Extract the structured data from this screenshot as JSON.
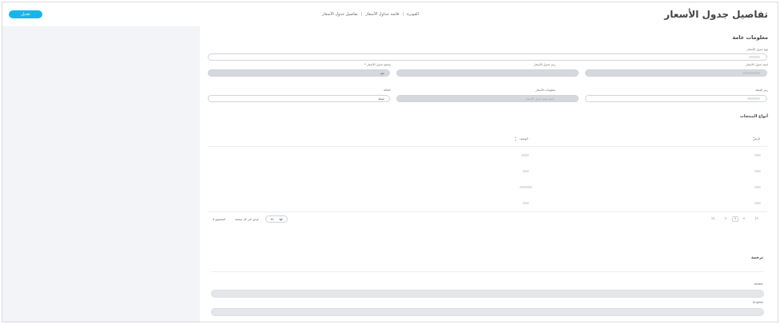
{
  "header": {
    "title": "تفاصيل جدول الأسعار",
    "breadcrumb": [
      "الفوترة",
      "قائمة جداول الأسعار",
      "تفاصيل جدول الأسعار"
    ],
    "edit_label": "تعديل"
  },
  "general_info": {
    "title": "معلومات عامة",
    "fields": {
      "price_table_type": {
        "label": "نوع جدول الأسعار",
        "value": ""
      },
      "price_table_name": {
        "label": "اسم جدول الأسعار",
        "value": ""
      },
      "price_table_code": {
        "label": "رمز جدول الأسعار",
        "value": ""
      },
      "price_table_applies": {
        "label": "يسمح جدول الأسعار *",
        "value": "نعم"
      },
      "currency_code": {
        "label": "رمز العملة",
        "value": ""
      },
      "price_table_info": {
        "label": "معلومات الأسعار",
        "value": "اسم منتج جدول الأسعار"
      },
      "status": {
        "label": "الحالة",
        "value": "نشط"
      }
    }
  },
  "products": {
    "title": "أنواع المنتجات",
    "columns": [
      "الرمز",
      "الوصف"
    ],
    "rows": [
      [
        "",
        ""
      ],
      [
        "",
        ""
      ],
      [
        "",
        ""
      ],
      [
        "",
        ""
      ]
    ]
  },
  "pagination": {
    "first": "|<",
    "prev": "<",
    "page": "1",
    "next": ">",
    "last": ">|",
    "per_page": "10",
    "per_page_label": "عرض في كل صفحة",
    "total_label": "المجموع 4"
  },
  "translation": {
    "title": "ترجمة",
    "languages": [
      "Arabic",
      "English"
    ]
  }
}
